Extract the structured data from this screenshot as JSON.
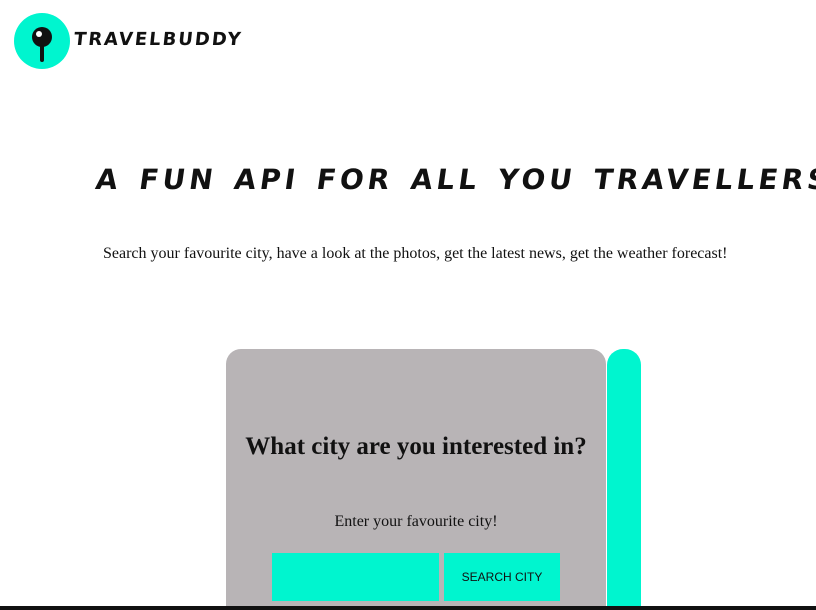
{
  "header": {
    "brand_name": "TRAVELBUDDY",
    "logo_icon": "map-pin-icon"
  },
  "hero": {
    "title": "A FUN API FOR ALL YOU TRAVELLERS!",
    "subtitle": "Search your favourite city, have a look at the photos, get the latest news, get the weather forecast!"
  },
  "search_card": {
    "title": "What city are you interested in?",
    "label": "Enter your favourite city!",
    "input_value": "",
    "input_placeholder": "",
    "button_label": "SEARCH CITY"
  },
  "colors": {
    "accent": "#00f5cf",
    "card_background": "#b8b4b6",
    "text": "#111111",
    "page_background": "#ffffff"
  }
}
